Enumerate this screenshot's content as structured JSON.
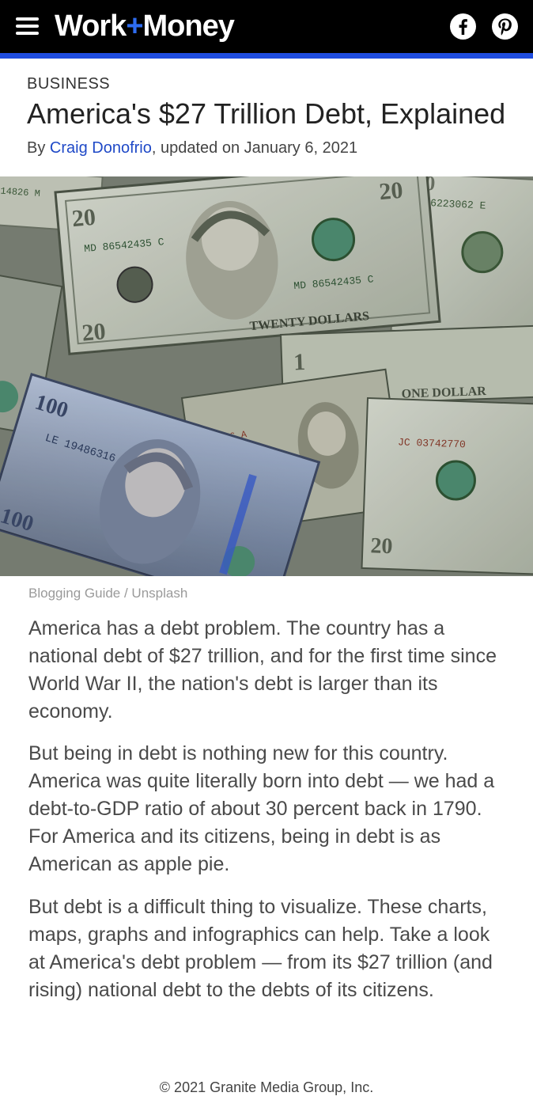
{
  "header": {
    "logo_part1": "Work",
    "logo_plus": "+",
    "logo_part2": "Money",
    "menu_icon": "hamburger-menu-icon",
    "social": [
      "facebook-icon",
      "pinterest-icon"
    ],
    "colors": {
      "bar": "#000000",
      "accent": "#1f4de0",
      "plus": "#2e6cf0"
    }
  },
  "article": {
    "category": "BUSINESS",
    "title": "America's $27 Trillion Debt, Explained",
    "byline_prefix": "By ",
    "author": "Craig Donofrio",
    "byline_suffix": ", updated on January 6, 2021",
    "image_caption": "Blogging Guide / Unsplash",
    "paragraphs": [
      "America has a debt problem. The country has a national debt of $27 trillion, and for the first time since World War II, the nation's debt is larger than its economy.",
      "But being in debt is nothing new for this country. America was quite literally born into debt — we had a debt-to-GDP ratio of about 30 percent back in 1790. For America and its citizens, being in debt is as American as apple pie.",
      "But debt is a difficult thing to visualize. These charts, maps, graphs and infographics can help. Take a look at America's debt problem — from its $27 trillion (and rising) national debt to the debts of its citizens."
    ],
    "hero_image": {
      "subject": "us-dollar-bills-photo",
      "note_20_serials": [
        "MD 86542435 C",
        "IC 46223062 E"
      ],
      "note_20_label": "TWENTY DOLLARS",
      "note_100_serial": "LE 19486316 E",
      "note_10_serial": "JC 03742770"
    }
  },
  "footer": {
    "copyright": "© 2021 Granite Media Group, Inc."
  }
}
